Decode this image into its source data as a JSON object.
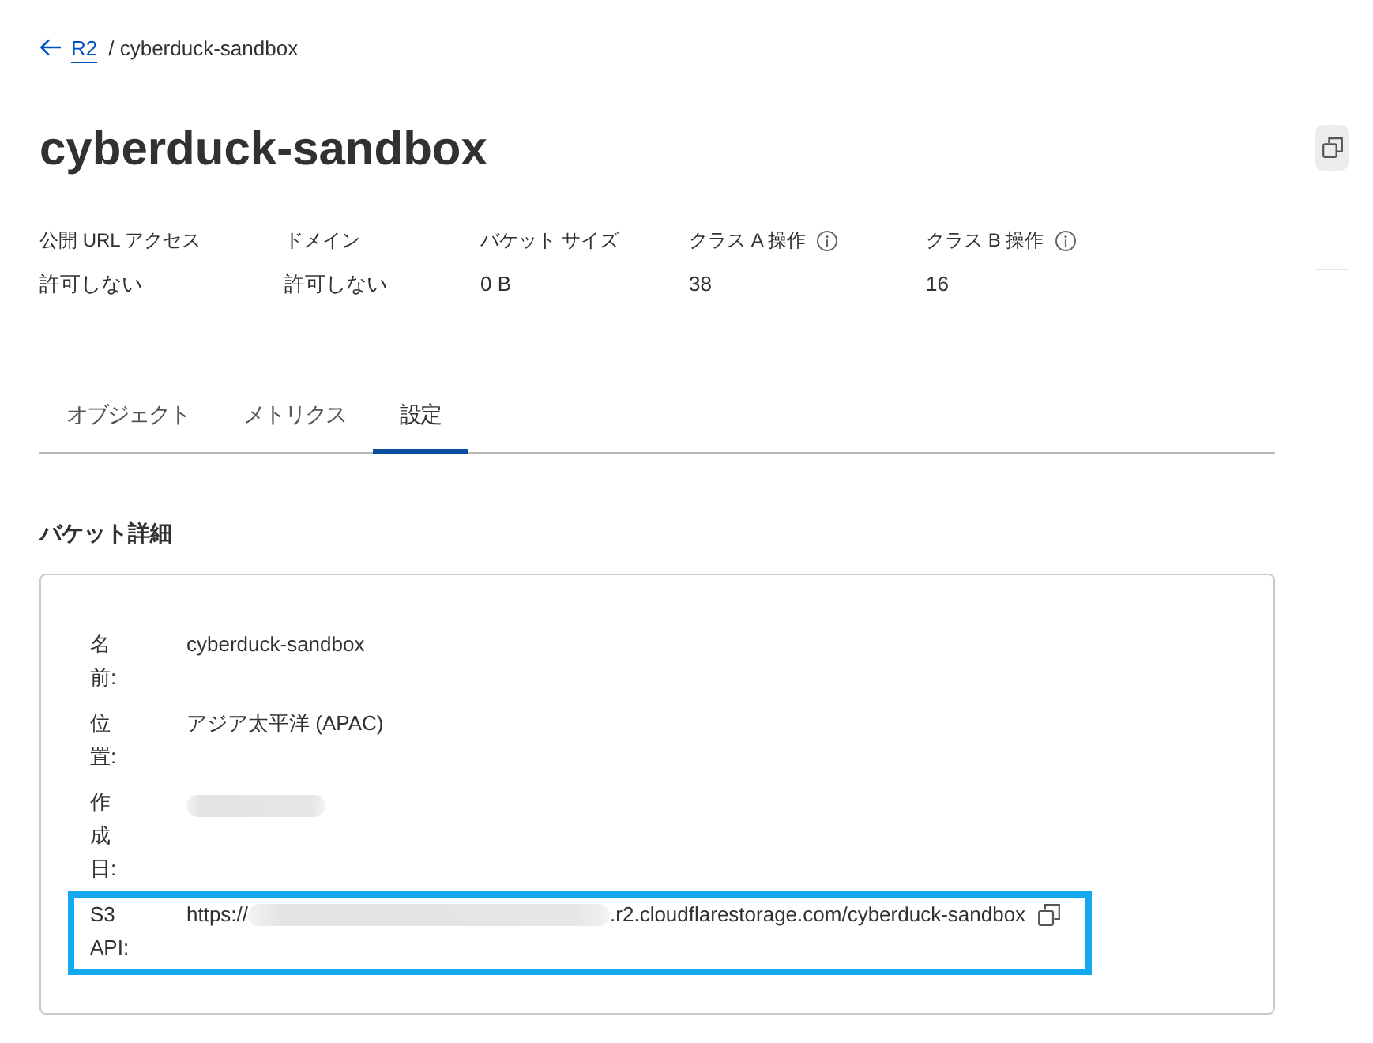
{
  "breadcrumb": {
    "back_link": "R2",
    "current": "/ cyberduck-sandbox"
  },
  "title": "cyberduck-sandbox",
  "stats": [
    {
      "label": "公開 URL アクセス",
      "value": "許可しない",
      "has_info": false
    },
    {
      "label": "ドメイン",
      "value": "許可しない",
      "has_info": false
    },
    {
      "label": "バケット サイズ",
      "value": "0 B",
      "has_info": false
    },
    {
      "label": "クラス A 操作",
      "value": "38",
      "has_info": true
    },
    {
      "label": "クラス B 操作",
      "value": "16",
      "has_info": true
    }
  ],
  "tabs": [
    {
      "label": "オブジェクト",
      "selected": false
    },
    {
      "label": "メトリクス",
      "selected": false
    },
    {
      "label": "設定",
      "selected": true
    }
  ],
  "section": {
    "heading": "バケット詳細",
    "rows": [
      {
        "kind": "text",
        "label": "名前:",
        "value": "cyberduck-sandbox",
        "highlighted": false
      },
      {
        "kind": "text",
        "label": "位置:",
        "value": "アジア太平洋 (APAC)",
        "highlighted": false
      },
      {
        "kind": "redacted",
        "label": "作成日:",
        "highlighted": false
      },
      {
        "kind": "url",
        "label": "S3 API:",
        "prefix": "https://",
        "suffix": ".r2.cloudflarestorage.com/cyberduck-sandbox",
        "highlighted": true
      }
    ]
  }
}
